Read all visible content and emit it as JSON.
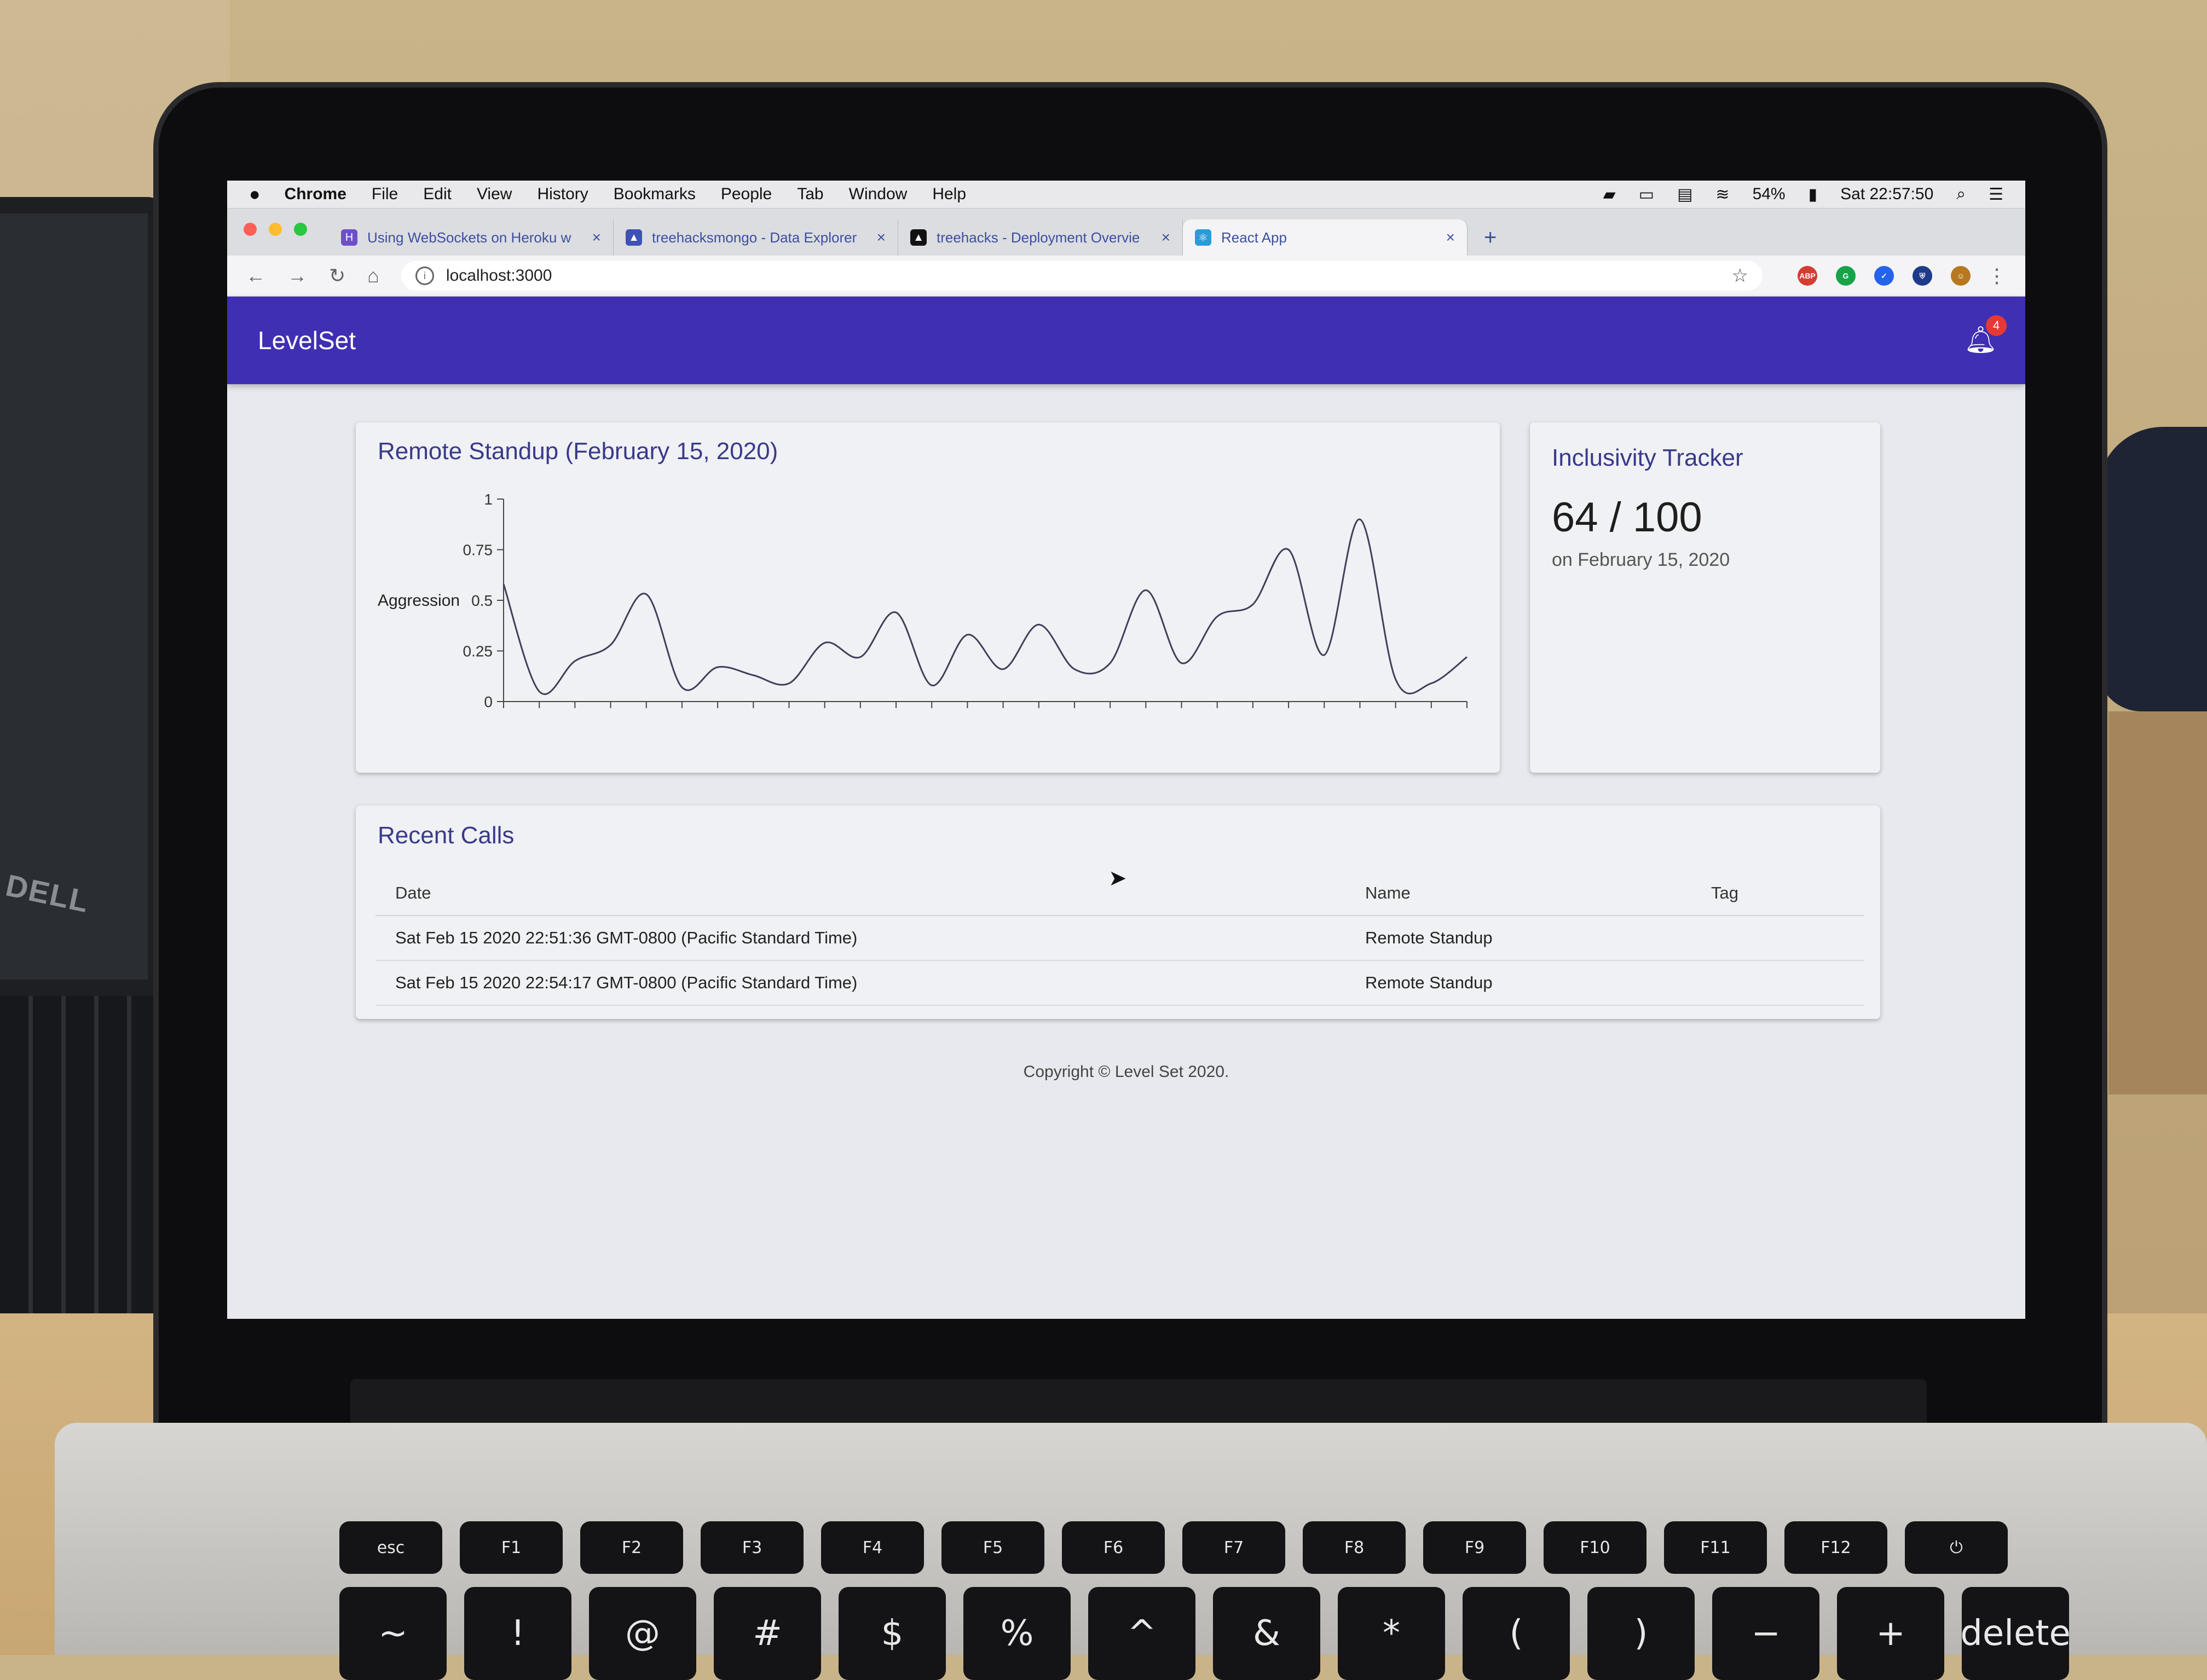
{
  "menubar": {
    "app": "Chrome",
    "items": [
      "File",
      "Edit",
      "View",
      "History",
      "Bookmarks",
      "People",
      "Tab",
      "Window",
      "Help"
    ],
    "battery": "54%",
    "clock": "Sat 22:57:50"
  },
  "tabs": [
    {
      "title": "Using WebSockets on Heroku w",
      "favicon_color": "#6d4fc7",
      "favicon_char": "H"
    },
    {
      "title": "treehacksmongo - Data Explorer",
      "favicon_color": "#3f51b5",
      "favicon_char": "▲"
    },
    {
      "title": "treehacks - Deployment Overvie",
      "favicon_color": "#111111",
      "favicon_char": "▲"
    },
    {
      "title": "React App",
      "favicon_color": "#2a9bd8",
      "favicon_char": "⚛"
    }
  ],
  "address": {
    "url": "localhost:3000"
  },
  "app": {
    "brand": "LevelSet",
    "notification_count": "4"
  },
  "chart_card": {
    "title": "Remote Standup (February 15, 2020)"
  },
  "chart_data": {
    "type": "line",
    "title": "Remote Standup (February 15, 2020)",
    "ylabel": "Aggression",
    "xlabel": "",
    "ylim": [
      0,
      1
    ],
    "yticks": [
      "0",
      "0.25",
      "0.5",
      "0.75",
      "1"
    ],
    "x_tick_count": 28,
    "series": [
      {
        "values": [
          0.58,
          0.05,
          0.2,
          0.28,
          0.53,
          0.07,
          0.17,
          0.13,
          0.09,
          0.29,
          0.22,
          0.44,
          0.08,
          0.33,
          0.16,
          0.38,
          0.16,
          0.19,
          0.55,
          0.19,
          0.42,
          0.48,
          0.75,
          0.23,
          0.9,
          0.11,
          0.09,
          0.22
        ],
        "color": "#3f3f5a"
      }
    ]
  },
  "tracker": {
    "title": "Inclusivity Tracker",
    "score": "64 / 100",
    "date": "on February 15, 2020"
  },
  "calls": {
    "title": "Recent Calls",
    "headers": {
      "date": "Date",
      "name": "Name",
      "tag": "Tag"
    },
    "rows": [
      {
        "date": "Sat Feb 15 2020 22:51:36 GMT-0800 (Pacific Standard Time)",
        "name": "Remote Standup",
        "tag": ""
      },
      {
        "date": "Sat Feb 15 2020 22:54:17 GMT-0800 (Pacific Standard Time)",
        "name": "Remote Standup",
        "tag": ""
      }
    ]
  },
  "footer": {
    "text": "Copyright © Level Set 2020."
  },
  "keyboard": {
    "fkeys": [
      "esc",
      "F1",
      "F2",
      "F3",
      "F4",
      "F5",
      "F6",
      "F7",
      "F8",
      "F9",
      "F10",
      "F11",
      "F12",
      "⏻"
    ],
    "numkeys": [
      "~",
      "!",
      "@",
      "#",
      "$",
      "%",
      "^",
      "&",
      "*",
      "(",
      ")",
      "−",
      "+",
      "delete"
    ]
  }
}
